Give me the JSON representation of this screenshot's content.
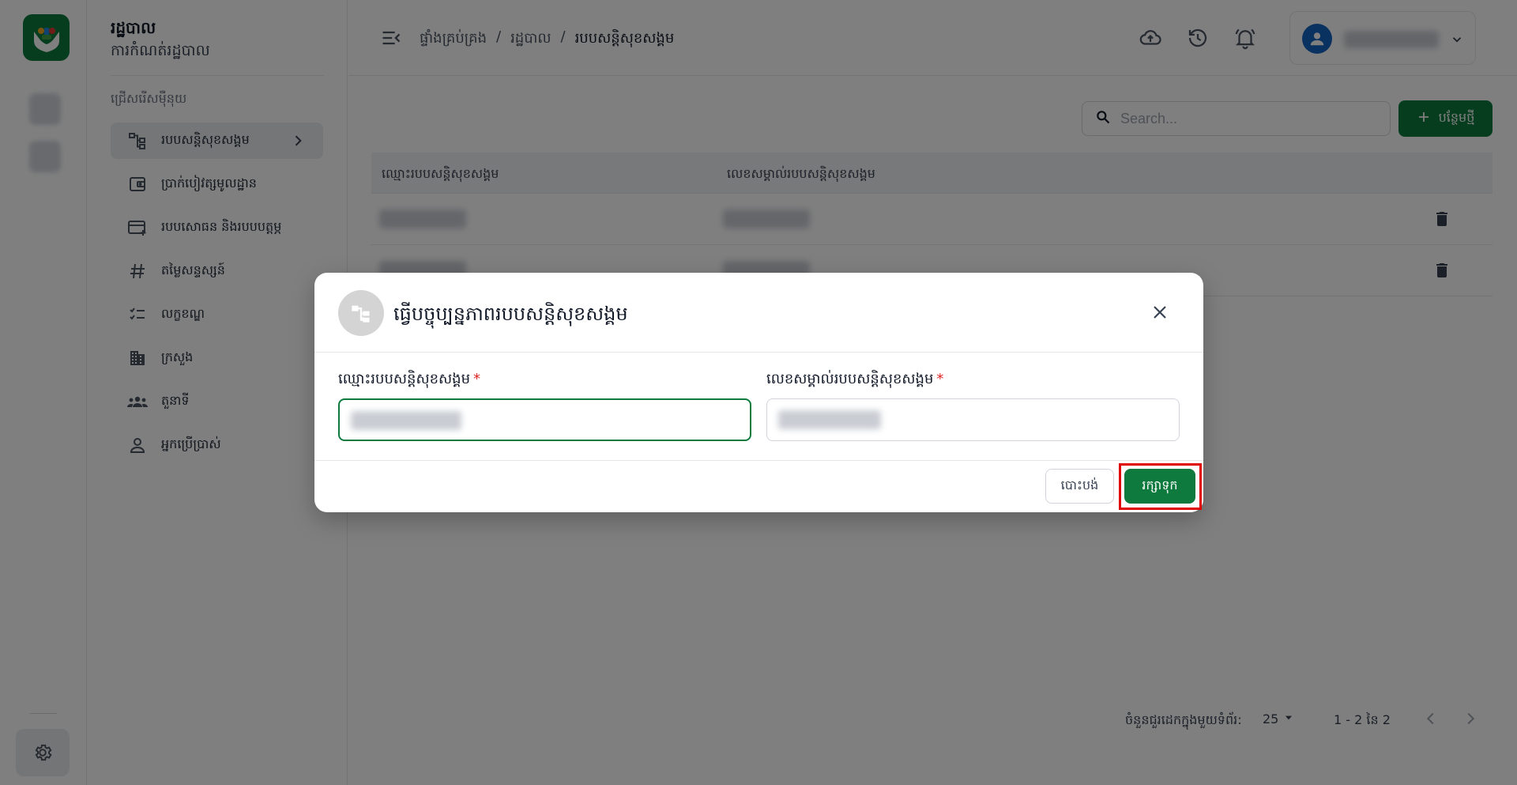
{
  "app": {
    "title": "រដ្ឋបាល",
    "subtitle": "ការកំណត់រដ្ឋបាល"
  },
  "sidebar": {
    "section_label": "ជ្រើសរើសម៉ឺនុយ",
    "items": [
      {
        "label": "របបសន្តិសុខសង្គម",
        "icon": "hierarchy-icon",
        "active": true
      },
      {
        "label": "ប្រាក់បៀវត្សមូលដ្ឋាន",
        "icon": "wallet-icon",
        "active": false
      },
      {
        "label": "របបសោធន និងរបបបត្តម្ភ",
        "icon": "card-add-icon",
        "active": false
      },
      {
        "label": "តម្លៃសន្ទស្សន៍",
        "icon": "hash-icon",
        "active": false
      },
      {
        "label": "លក្ខខណ្ឌ",
        "icon": "checklist-icon",
        "active": false
      },
      {
        "label": "ក្រសួង",
        "icon": "building-icon",
        "active": false
      },
      {
        "label": "តួនាទី",
        "icon": "group-icon",
        "active": false
      },
      {
        "label": "អ្នកប្រើប្រាស់",
        "icon": "person-icon",
        "active": false
      }
    ]
  },
  "breadcrumb": {
    "items": [
      "ផ្ទាំងគ្រប់គ្រង",
      "រដ្ឋបាល",
      "របបសន្តិសុខសង្គម"
    ],
    "separator": "/"
  },
  "toolbar": {
    "search_placeholder": "Search...",
    "add_label": "បន្ថែមថ្មី"
  },
  "table": {
    "columns": [
      "ឈ្មោះរបបសន្តិសុខសង្គម",
      "លេខសម្គាល់របបសន្តិសុខសង្គម"
    ],
    "row_count": 2
  },
  "pagination": {
    "rows_per_page_label": "ចំនួនជួរដេកក្នុងមួយទំព័រ:",
    "rows_per_page_value": "25",
    "range_text": "1 - 2 នៃ 2"
  },
  "dialog": {
    "title": "ធ្វើបច្ចុប្បន្នភាពរបបសន្តិសុខសង្គម",
    "field1_label": "ឈ្មោះរបបសន្តិសុខសង្គម",
    "field2_label": "លេខសម្គាល់របបសន្តិសុខសង្គម",
    "required_mark": "*",
    "cancel_label": "បោះបង់",
    "save_label": "រក្សាទុក"
  },
  "colors": {
    "brand_green": "#0e7a3e",
    "highlight_red": "#e00000",
    "avatar_blue": "#1565c0"
  }
}
